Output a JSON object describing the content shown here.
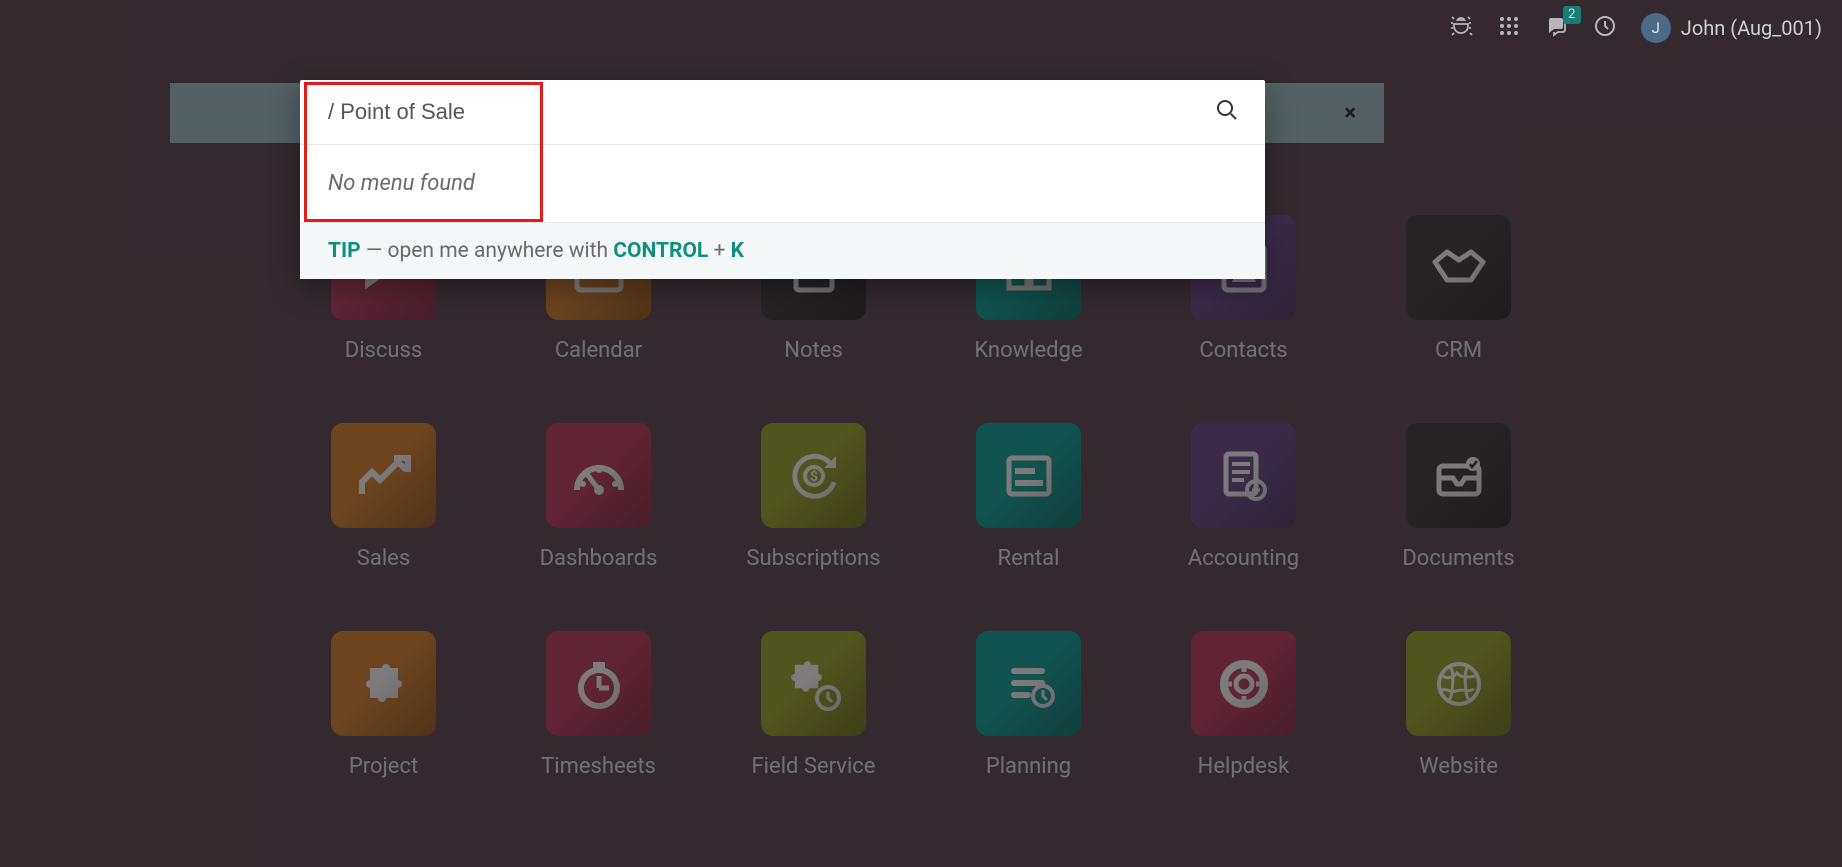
{
  "topbar": {
    "user_initial": "J",
    "user_name": "John (Aug_001)",
    "messages_badge": "2"
  },
  "palette": {
    "search_value": "/ Point of Sale",
    "no_result": "No menu found",
    "tip_label": "TIP",
    "tip_middle": " — open me anywhere with ",
    "tip_key1": "CONTROL",
    "tip_plus": " + ",
    "tip_key2": "K"
  },
  "search_strip": {
    "close": "×"
  },
  "apps": [
    {
      "label": "Discuss",
      "color": "#bf3f63",
      "icon": "chat"
    },
    {
      "label": "Calendar",
      "color": "#d9852e",
      "icon": "calendar"
    },
    {
      "label": "Notes",
      "color": "#3d3d3d",
      "icon": "note"
    },
    {
      "label": "Knowledge",
      "color": "#0fa89a",
      "icon": "book"
    },
    {
      "label": "Contacts",
      "color": "#6b4f8a",
      "icon": "contact"
    },
    {
      "label": "CRM",
      "color": "#3d3d3d",
      "icon": "handshake"
    },
    {
      "label": "Sales",
      "color": "#d9852e",
      "icon": "sales"
    },
    {
      "label": "Dashboards",
      "color": "#bf3f63",
      "icon": "gauge"
    },
    {
      "label": "Subscriptions",
      "color": "#9aa82a",
      "icon": "cycle"
    },
    {
      "label": "Rental",
      "color": "#0fa89a",
      "icon": "rental"
    },
    {
      "label": "Accounting",
      "color": "#6b4f8a",
      "icon": "accounting"
    },
    {
      "label": "Documents",
      "color": "#3d3d3d",
      "icon": "inbox"
    },
    {
      "label": "Project",
      "color": "#d9852e",
      "icon": "puzzle"
    },
    {
      "label": "Timesheets",
      "color": "#bf3f63",
      "icon": "stopwatch"
    },
    {
      "label": "Field Service",
      "color": "#9aa82a",
      "icon": "puzzle-clock"
    },
    {
      "label": "Planning",
      "color": "#0fa89a",
      "icon": "planning"
    },
    {
      "label": "Helpdesk",
      "color": "#bf3f63",
      "icon": "lifebuoy"
    },
    {
      "label": "Website",
      "color": "#9aa82a",
      "icon": "globe"
    }
  ]
}
